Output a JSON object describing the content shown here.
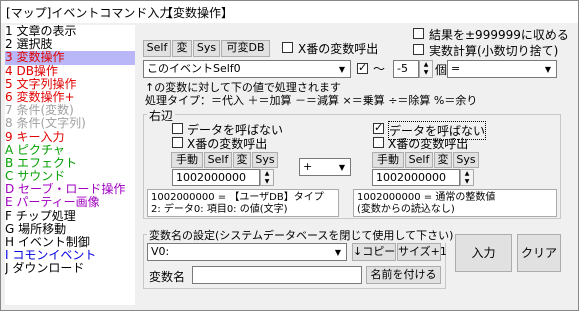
{
  "title": "[マップ]イベントコマンド入力",
  "subtitle": "【変数操作】",
  "commands": [
    {
      "label": "1 文章の表示",
      "color": "#000000",
      "selected": false
    },
    {
      "label": "2 選択肢",
      "color": "#000000",
      "selected": false
    },
    {
      "label": "3 変数操作",
      "color": "#e00000",
      "selected": true
    },
    {
      "label": "4 DB操作",
      "color": "#e00000",
      "selected": false
    },
    {
      "label": "5 文字列操作",
      "color": "#e00000",
      "selected": false
    },
    {
      "label": "6 変数操作+",
      "color": "#e00000",
      "selected": false
    },
    {
      "label": "7 条件(変数)",
      "color": "#a0a0a0",
      "selected": false
    },
    {
      "label": "8 条件(文字列)",
      "color": "#a0a0a0",
      "selected": false
    },
    {
      "label": "9 キー入力",
      "color": "#e00000",
      "selected": false
    },
    {
      "label": "A ピクチャ",
      "color": "#00a000",
      "selected": false
    },
    {
      "label": "B エフェクト",
      "color": "#00a000",
      "selected": false
    },
    {
      "label": "C サウンド",
      "color": "#00a000",
      "selected": false
    },
    {
      "label": "D セーブ・ロード操作",
      "color": "#a000c0",
      "selected": false
    },
    {
      "label": "E パーティー画像",
      "color": "#a000c0",
      "selected": false
    },
    {
      "label": "F チップ処理",
      "color": "#000000",
      "selected": false
    },
    {
      "label": "G 場所移動",
      "color": "#000000",
      "selected": false
    },
    {
      "label": "H イベント制御",
      "color": "#000000",
      "selected": false
    },
    {
      "label": "I コモンイベント",
      "color": "#0000e0",
      "selected": false
    },
    {
      "label": "J ダウンロード",
      "color": "#000000",
      "selected": false
    }
  ],
  "top_buttons": {
    "self": "Self",
    "var": "変",
    "sys": "Sys",
    "vardb": "可変DB"
  },
  "x_var_call_label": "X番の変数呼出",
  "limit_label": "結果を±999999に収める",
  "real_calc_label": "実数計算(小数切り捨て)",
  "target_select": "このイベントSelf0",
  "tilde": "〜",
  "count_value": "-5",
  "count_unit": "個",
  "assign_op": "=",
  "description": "↑の変数に対して下の値で処理されます\n処理タイプ：＝代入 ＋＝加算 －＝減算 ×＝乗算 ÷＝除算 %＝余り",
  "right_group_title": "右辺",
  "left_side": {
    "no_call_label": "データを呼ばない",
    "x_call_label": "X番の変数呼出",
    "manual": "手動",
    "self": "Self",
    "var": "変",
    "sys": "Sys",
    "value": "1002000000",
    "info": "1002000000 = 【ユーザDB】タイプ\n2: データ0: 項目0: の値(文字)"
  },
  "operator": "+",
  "right_side": {
    "no_call_label": "データを呼ばない",
    "x_call_label": "X番の変数呼出",
    "manual": "手動",
    "self": "Self",
    "var": "変",
    "sys": "Sys",
    "value": "1002000000",
    "info": "1002000000 = 通常の整数値\n(変数からの読込なし)"
  },
  "name_group_title": "変数名の設定(システムデータベースを閉じて使用して下さい)",
  "name_select": "V0:",
  "copy_label": "↓コピー",
  "size_label": "サイズ+1",
  "var_name_label": "変数名",
  "name_button": "名前を付ける",
  "input_button": "入力",
  "clear_button": "クリア"
}
